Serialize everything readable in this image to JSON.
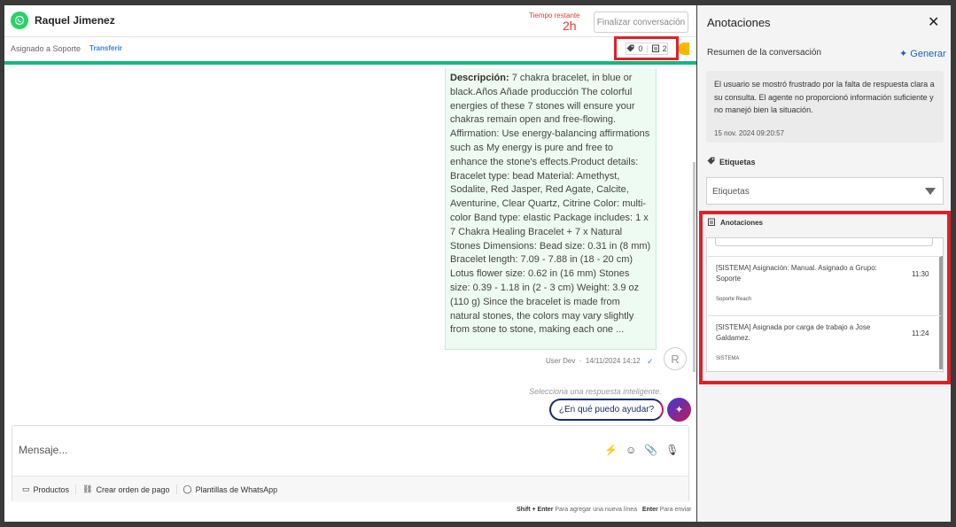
{
  "header": {
    "contact_name": "Raquel Jimenez",
    "time_remaining_label": "Tiempo restante",
    "time_remaining_value": "2h",
    "finalize_button": "Finalizar conversación"
  },
  "subheader": {
    "assigned": "Asignado a Soporte",
    "transfer": "Transferir",
    "tag_count": "0",
    "note_count": "2"
  },
  "message": {
    "label": "Descripción:",
    "body": " 7 chakra bracelet, in blue or black.Años Añade producción The colorful energies of these 7 stones will ensure your chakras remain open and free-flowing. Affirmation: Use energy-balancing affirmations such as My energy is pure and free to enhance the stone's effects.Product details: Bracelet type: bead Material: Amethyst, Sodalite, Red Jasper, Red Agate, Calcite, Aventurine, Clear Quartz, Citrine Color: multi-color Band type: elastic Package includes: 1 x 7 Chakra Healing Bracelet + 7 x Natural Stones Dimensions: Bead size: 0.31 in (8 mm) Bracelet length: 7.09 - 7.88 in (18 - 20 cm) Lotus flower size: 0.62 in (16 mm) Stones size: 0.39 - 1.18 in (2 - 3 cm) Weight: 3.9 oz (110 g) Since the bracelet is made from natural stones, the colors may vary slightly from stone to stone, making each one ...",
    "sender": "User Dev",
    "separator": "·",
    "datetime": "14/11/2024 14:12",
    "avatar_letter": "R"
  },
  "smart_reply": {
    "hint": "Selecciona una respuesta inteligente.",
    "suggestion": "¿En qué puedo ayudar?"
  },
  "composer": {
    "placeholder": "Mensaje...",
    "footer": [
      "Productos",
      "Crear orden de pago",
      "Plantillas de WhatsApp"
    ],
    "shortcut_1_key": "Shift + Enter",
    "shortcut_1_text": "Para agregar una nueva línea",
    "shortcut_2_key": "Enter",
    "shortcut_2_text": "Para enviar"
  },
  "sidebar": {
    "title": "Anotaciones",
    "summary_label": "Resumen de la conversación",
    "generate": "Generar",
    "summary_text": "El usuario se mostró frustrado por la falta de respuesta clara a su consulta. El agente no proporcionó información suficiente y no manejó bien la situación.",
    "summary_date": "15 nov. 2024 09:20:57",
    "tags_label": "Etiquetas",
    "tags_placeholder": "Etiquetas",
    "notes_label": "Anotaciones",
    "notes": [
      {
        "text": "[SISTEMA] Asignación: Manual. Asignado a Grupo: Soporte",
        "time": "11:30",
        "author": "Soporte Reach"
      },
      {
        "text": "[SISTEMA] Asignada por carga de trabajo a Jose Galdamez.",
        "time": "11:24",
        "author": "SISTEMA"
      }
    ]
  },
  "colors": {
    "accent_green": "#16b77d",
    "alert_red": "#e53935",
    "highlight_red": "#e01f2a",
    "link_blue": "#2f80ed"
  }
}
